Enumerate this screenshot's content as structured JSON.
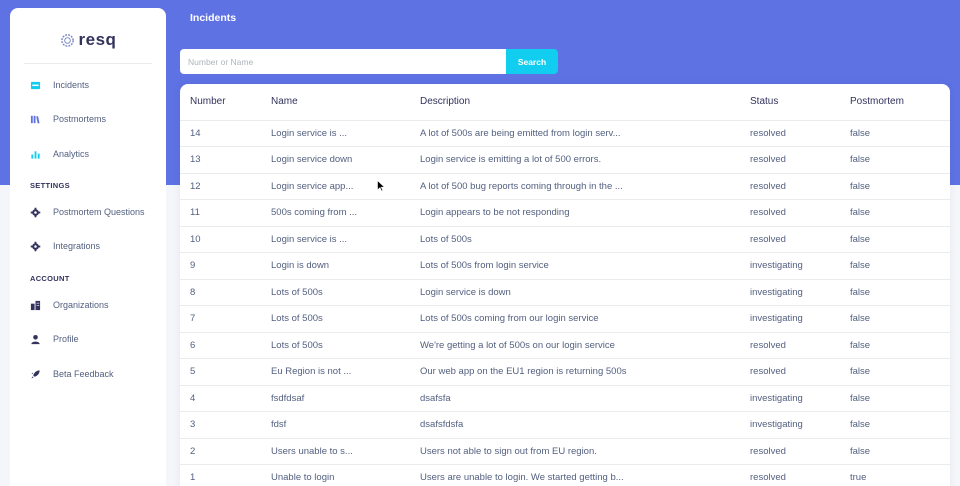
{
  "app": {
    "logo_text": "resq",
    "page_title": "Incidents"
  },
  "sidebar": {
    "items": [
      {
        "label": "Incidents",
        "icon": "inbox-icon"
      },
      {
        "label": "Postmortems",
        "icon": "books-icon"
      },
      {
        "label": "Analytics",
        "icon": "bar-chart-icon"
      }
    ],
    "settings_title": "SETTINGS",
    "settings_items": [
      {
        "label": "Postmortem Questions",
        "icon": "gear-icon"
      },
      {
        "label": "Integrations",
        "icon": "gear-icon"
      }
    ],
    "account_title": "ACCOUNT",
    "account_items": [
      {
        "label": "Organizations",
        "icon": "building-icon"
      },
      {
        "label": "Profile",
        "icon": "user-icon"
      },
      {
        "label": "Beta Feedback",
        "icon": "rocket-icon"
      }
    ]
  },
  "search": {
    "placeholder": "Number or Name",
    "value": "",
    "button_label": "Search"
  },
  "table": {
    "headers": [
      "Number",
      "Name",
      "Description",
      "Status",
      "Postmortem"
    ],
    "rows": [
      [
        "14",
        "Login service is ...",
        "A lot of 500s are being emitted from login serv...",
        "resolved",
        "false"
      ],
      [
        "13",
        "Login service down",
        "Login service is emitting a lot of 500 errors.",
        "resolved",
        "false"
      ],
      [
        "12",
        "Login service app...",
        "A lot of 500 bug reports coming through in the ...",
        "resolved",
        "false"
      ],
      [
        "11",
        "500s coming from ...",
        "Login appears to be not responding",
        "resolved",
        "false"
      ],
      [
        "10",
        "Login service is ...",
        "Lots of 500s",
        "resolved",
        "false"
      ],
      [
        "9",
        "Login is down",
        "Lots of 500s from login service",
        "investigating",
        "false"
      ],
      [
        "8",
        "Lots of 500s",
        "Login service is down",
        "investigating",
        "false"
      ],
      [
        "7",
        "Lots of 500s",
        "Lots of 500s coming from our login service",
        "investigating",
        "false"
      ],
      [
        "6",
        "Lots of 500s",
        "We're getting a lot of 500s on our login service",
        "resolved",
        "false"
      ],
      [
        "5",
        "Eu Region is not ...",
        "Our web app on the EU1 region is returning 500s",
        "resolved",
        "false"
      ],
      [
        "4",
        "fsdfdsaf",
        "dsafsfa",
        "investigating",
        "false"
      ],
      [
        "3",
        "fdsf",
        "dsafsfdsfa",
        "investigating",
        "false"
      ],
      [
        "2",
        "Users unable to s...",
        "Users not able to sign out from EU region.",
        "resolved",
        "false"
      ],
      [
        "1",
        "Unable to login",
        "Users are unable to login. We started getting b...",
        "resolved",
        "true"
      ]
    ]
  },
  "colors": {
    "primary": "#5e72e4",
    "info": "#11cdef",
    "text": "#525f7f",
    "heading": "#32325d"
  }
}
